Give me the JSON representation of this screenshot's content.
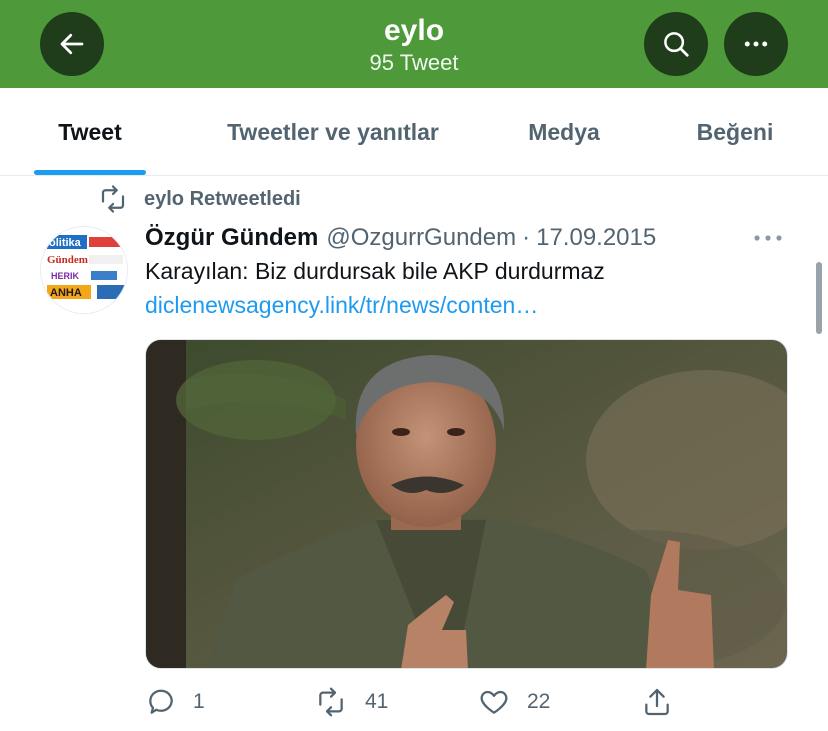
{
  "header": {
    "title": "eylo",
    "subtitle": "95 Tweet",
    "back_icon": "arrow-left-icon",
    "search_icon": "search-icon",
    "more_icon": "more-horizontal-icon",
    "bg_color": "#4e9a3b"
  },
  "tabs": [
    {
      "label": "Tweet",
      "active": true
    },
    {
      "label": "Tweetler ve yanıtlar",
      "active": false
    },
    {
      "label": "Medya",
      "active": false
    },
    {
      "label": "Beğeni",
      "active": false
    }
  ],
  "tweet": {
    "retweet_label": "eylo Retweetledi",
    "author_name": "Özgür Gündem",
    "author_handle": "@OzgurrGundem",
    "separator": "·",
    "date": "17.09.2015",
    "text": "Karayılan: Biz durdursak bile AKP durdurmaz",
    "link": "diclenewsagency.link/tr/news/conten…",
    "avatar_lines": [
      "olitika",
      "Gündem",
      "HERIK",
      "ANHA"
    ],
    "actions": {
      "reply_count": "1",
      "retweet_count": "41",
      "like_count": "22"
    }
  },
  "colors": {
    "accent": "#1d9bf0",
    "muted": "#536471"
  }
}
